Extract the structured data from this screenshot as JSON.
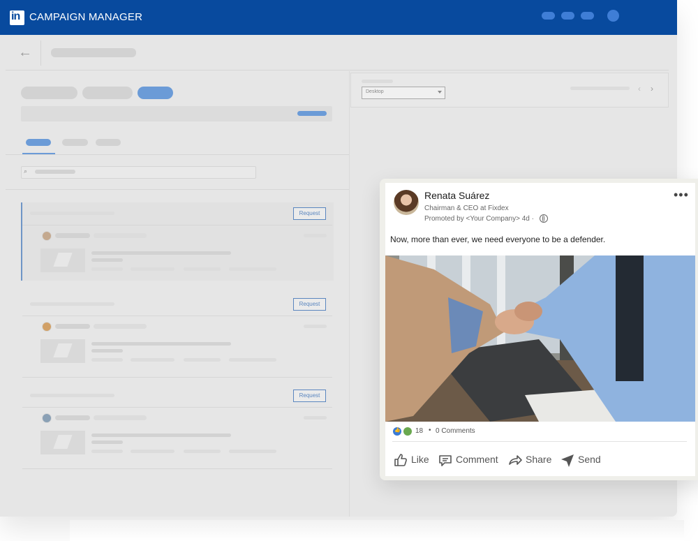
{
  "app": {
    "logo": "in",
    "title": "CAMPAIGN MANAGER"
  },
  "cards": [
    {
      "request_label": "Request"
    },
    {
      "request_label": "Request"
    },
    {
      "request_label": "Request"
    }
  ],
  "filter": {
    "device_selected": "Desktop"
  },
  "post": {
    "author_name": "Renata Suárez",
    "author_title": "Chairman & CEO at Fixdex",
    "promoted_line": "Promoted by <Your Company> 4d ·",
    "text": "Now, more than ever, we need everyone to be a defender.",
    "reaction_count": "18",
    "separator": "•",
    "comments": "0 Comments",
    "actions": {
      "like": "Like",
      "comment": "Comment",
      "share": "Share",
      "send": "Send"
    }
  },
  "colors": {
    "brand": "#084a9e",
    "accent": "#3f7ed6"
  }
}
